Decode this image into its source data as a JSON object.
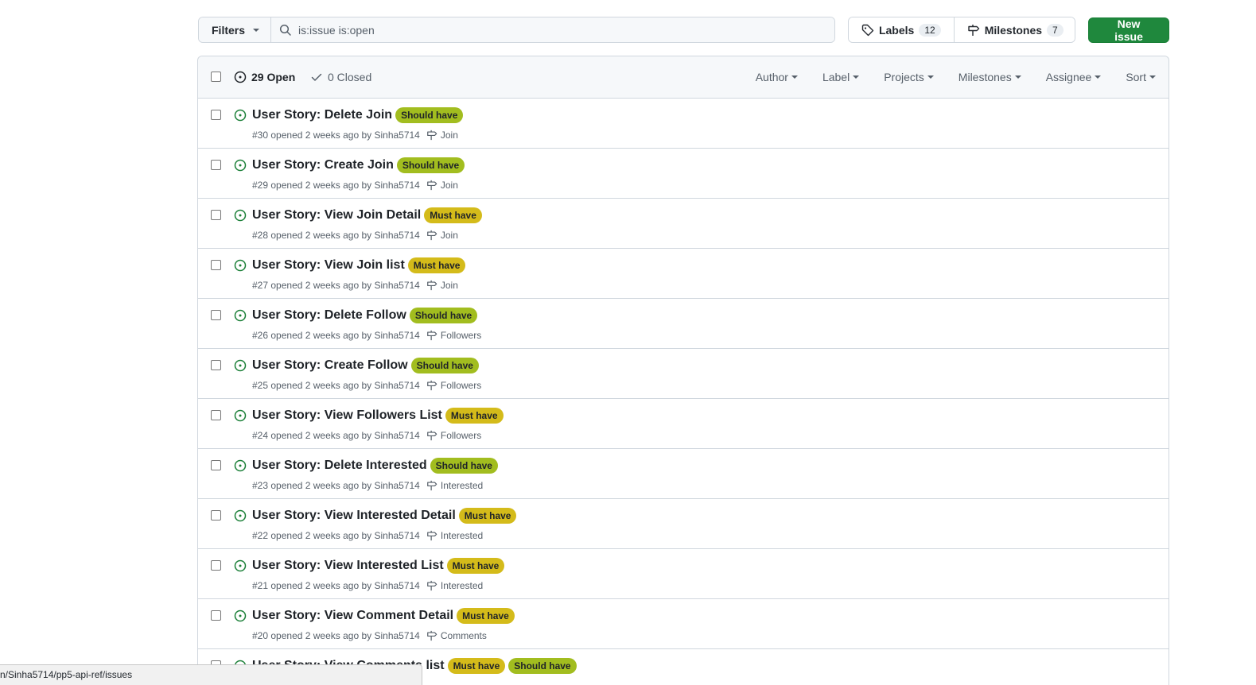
{
  "toolbar": {
    "filters_label": "Filters",
    "search_value": "is:issue is:open",
    "labels_label": "Labels",
    "labels_count": "12",
    "milestones_label": "Milestones",
    "milestones_count": "7",
    "new_issue_label": "New issue"
  },
  "list_header": {
    "open_label": "29 Open",
    "closed_label": "0 Closed",
    "filters": [
      "Author",
      "Label",
      "Projects",
      "Milestones",
      "Assignee",
      "Sort"
    ]
  },
  "colors": {
    "should_have": "#a2bd1f",
    "must_have": "#d4bb1a",
    "open_icon": "#1a7f37",
    "primary_button": "#1f883d"
  },
  "issues": [
    {
      "title": "User Story: Delete Join",
      "labels": [
        "Should have"
      ],
      "number": "#30",
      "opened": "opened 2 weeks ago by Sinha5714",
      "milestone": "Join"
    },
    {
      "title": "User Story: Create Join",
      "labels": [
        "Should have"
      ],
      "number": "#29",
      "opened": "opened 2 weeks ago by Sinha5714",
      "milestone": "Join"
    },
    {
      "title": "User Story: View Join Detail",
      "labels": [
        "Must have"
      ],
      "number": "#28",
      "opened": "opened 2 weeks ago by Sinha5714",
      "milestone": "Join"
    },
    {
      "title": "User Story: View Join list",
      "labels": [
        "Must have"
      ],
      "number": "#27",
      "opened": "opened 2 weeks ago by Sinha5714",
      "milestone": "Join"
    },
    {
      "title": "User Story: Delete Follow",
      "labels": [
        "Should have"
      ],
      "number": "#26",
      "opened": "opened 2 weeks ago by Sinha5714",
      "milestone": "Followers"
    },
    {
      "title": "User Story: Create Follow",
      "labels": [
        "Should have"
      ],
      "number": "#25",
      "opened": "opened 2 weeks ago by Sinha5714",
      "milestone": "Followers"
    },
    {
      "title": "User Story: View Followers List",
      "labels": [
        "Must have"
      ],
      "number": "#24",
      "opened": "opened 2 weeks ago by Sinha5714",
      "milestone": "Followers"
    },
    {
      "title": "User Story: Delete Interested",
      "labels": [
        "Should have"
      ],
      "number": "#23",
      "opened": "opened 2 weeks ago by Sinha5714",
      "milestone": "Interested"
    },
    {
      "title": "User Story: View Interested Detail",
      "labels": [
        "Must have"
      ],
      "number": "#22",
      "opened": "opened 2 weeks ago by Sinha5714",
      "milestone": "Interested"
    },
    {
      "title": "User Story: View Interested List",
      "labels": [
        "Must have"
      ],
      "number": "#21",
      "opened": "opened 2 weeks ago by Sinha5714",
      "milestone": "Interested"
    },
    {
      "title": "User Story: View Comment Detail",
      "labels": [
        "Must have"
      ],
      "number": "#20",
      "opened": "opened 2 weeks ago by Sinha5714",
      "milestone": "Comments"
    },
    {
      "title": "User Story: View Comments list",
      "labels": [
        "Must have",
        "Should have"
      ],
      "number": "",
      "opened": "",
      "milestone": ""
    }
  ],
  "statusbar": {
    "url": "n/Sinha5714/pp5-api-ref/issues"
  }
}
